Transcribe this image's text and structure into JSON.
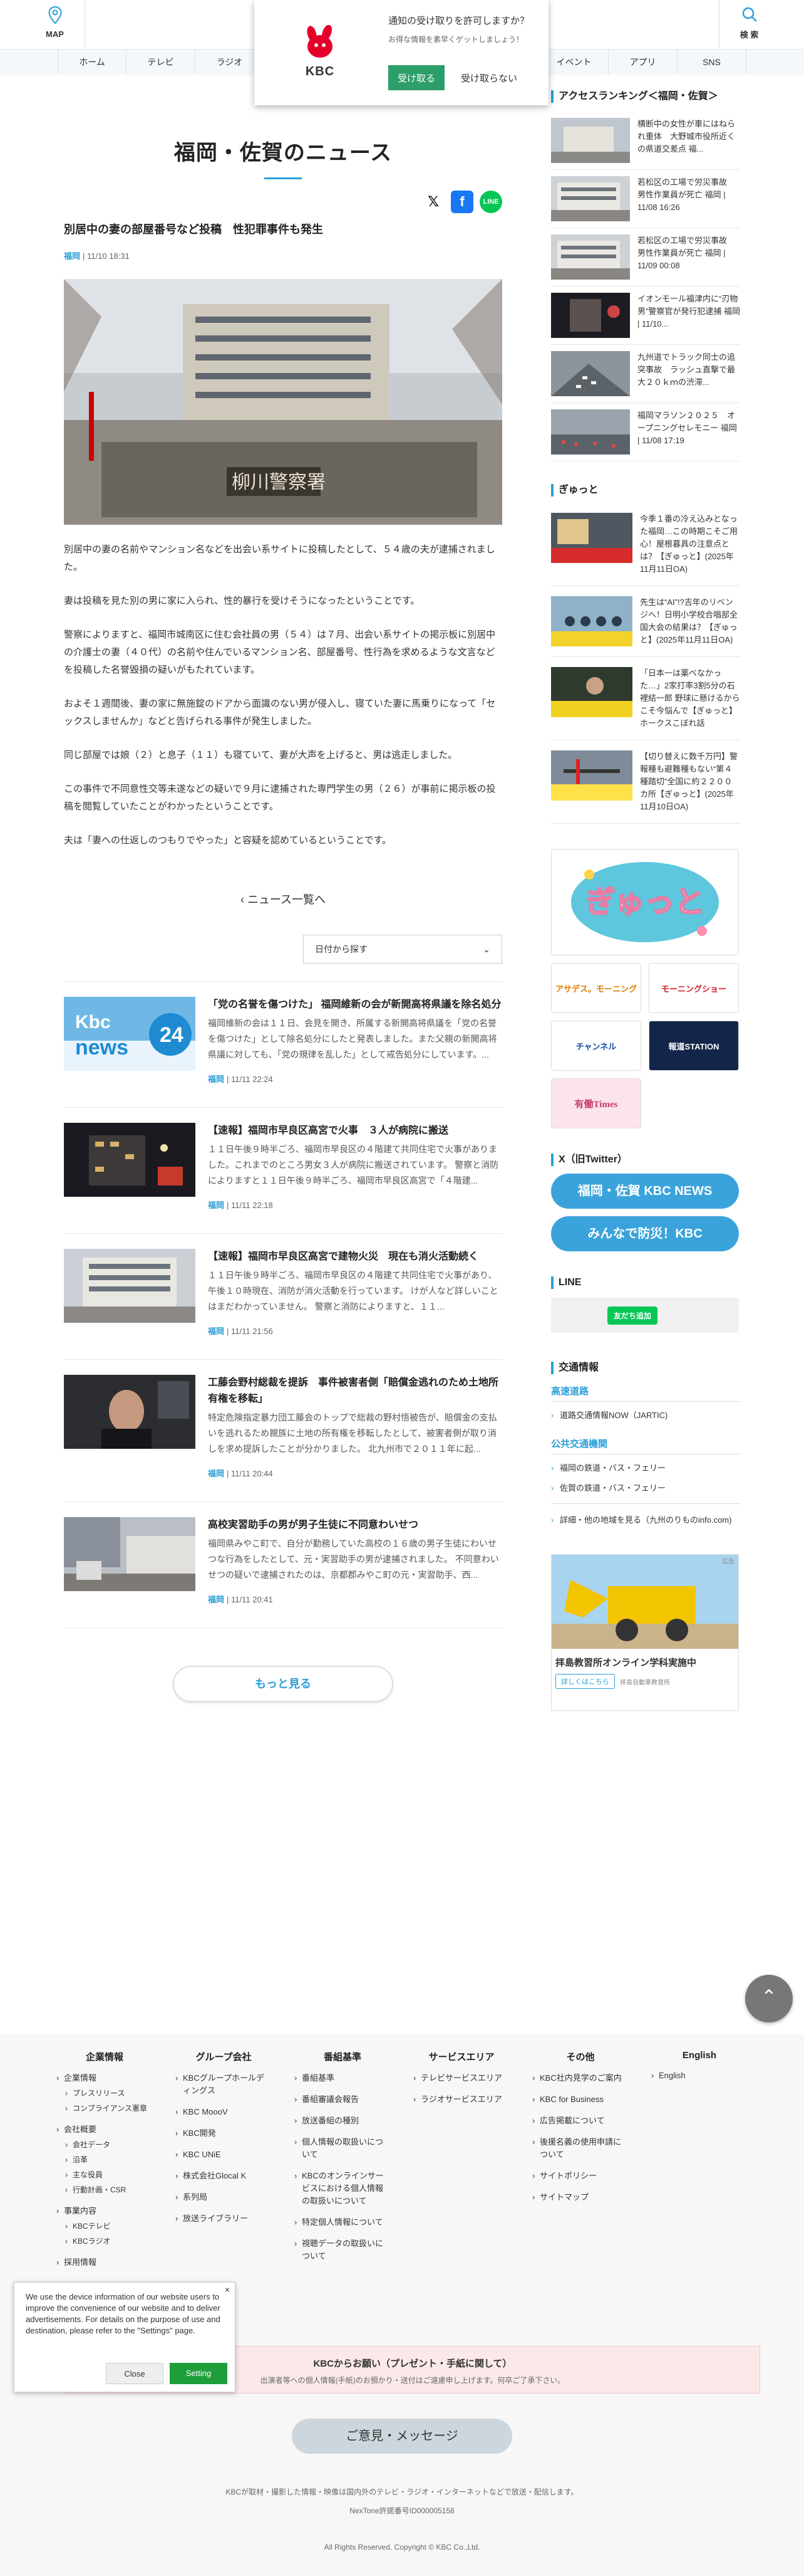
{
  "header": {
    "map_label": "MAP",
    "search_label": "検 索",
    "nav": [
      "ホーム",
      "テレビ",
      "ラジオ",
      "",
      "",
      "",
      "",
      "イベント",
      "アプリ",
      "SNS"
    ]
  },
  "notification": {
    "question": "通知の受け取りを許可しますか？",
    "sub": "お得な情報を素早くゲットしましょう！",
    "allow": "受け取る",
    "deny": "受け取らない",
    "logo_text": "KBC"
  },
  "main": {
    "page_title": "福岡・佐賀のニュース",
    "article": {
      "title": "別居中の妻の部屋番号など投稿　性犯罪事件も発生",
      "category": "福岡",
      "date": "11/10 18:31",
      "body": [
        "別居中の妻の名前やマンション名などを出会い系サイトに投稿したとして、５４歳の夫が逮捕されました。",
        "妻は投稿を見た別の男に家に入られ、性的暴行を受けそうになったということです。",
        "警察によりますと、福岡市城南区に住む会社員の男（５４）は７月、出会い系サイトの掲示板に別居中の介護士の妻（４０代）の名前や住んでいるマンション名、部屋番号、性行為を求めるような文言などを投稿した名誉毀損の疑いがもたれています。",
        "およそ１週間後、妻の家に無施錠のドアから面識のない男が侵入し、寝ていた妻に馬乗りになって「セックスしませんか」などと告げられる事件が発生しました。",
        "同じ部屋では娘（２）と息子（１１）も寝ていて、妻が大声を上げると、男は逃走しました。",
        "この事件で不同意性交等未遂などの疑いで９月に逮捕された専門学生の男（２６）が事前に掲示板の投稿を閲覧していたことがわかったということです。",
        "夫は「妻への仕返しのつもりでやった」と容疑を認めているということです。"
      ]
    },
    "back_label": "ニュース一覧へ",
    "sort_label": "日付から探す",
    "news": [
      {
        "title": "「党の名誉を傷つけた」 福岡維新の会が新開高将県議を除名処分",
        "text": "福岡維新の会は１１日、会見を開き、所属する新開高将県議を「党の名誉を傷つけた」として除名処分にしたと発表しました。また父親の新開高将県議に対しても、「党の規律を乱した」として戒告処分にしています。...",
        "category": "福岡",
        "date": "11/11 22:24"
      },
      {
        "title": "【速報】福岡市早良区高宮で火事　３人が病院に搬送",
        "text": "１１日午後９時半ごろ、福岡市早良区の４階建て共同住宅で火事がありました。これまでのところ男女３人が病院に搬送されています。 警察と消防によりますと１１日午後９時半ごろ、福岡市早良区高宮で「４階建...",
        "category": "福岡",
        "date": "11/11 22:18"
      },
      {
        "title": "【速報】福岡市早良区高宮で建物火災　現在も消火活動続く",
        "text": "１１日午後９時半ごろ、福岡市早良区の４階建て共同住宅で火事があり、午後１０時現在、消防が消火活動を行っています。 けが人など詳しいことはまだわかっていません。 警察と消防によりますと、１１...",
        "category": "福岡",
        "date": "11/11 21:56"
      },
      {
        "title": "工藤会野村総裁を提訴　事件被害者側「賠償金逃れのため土地所有権を移転」",
        "text": "特定危険指定暴力団工藤会のトップで総裁の野村悟被告が、賠償金の支払いを逃れるため親族に土地の所有権を移転したとして、被害者側が取り消しを求め提訴したことが分かりました。 北九州市で２０１１年に起...",
        "category": "福岡",
        "date": "11/11 20:44"
      },
      {
        "title": "高校実習助手の男が男子生徒に不同意わいせつ",
        "text": "福岡県みやこ町で、自分が勤務していた高校の１６歳の男子生徒にわいせつな行為をしたとして、元・実習助手の男が逮捕されました。 不同意わいせつの疑いで逮捕されたのは、京都郡みやこ町の元・実習助手、西...",
        "category": "福岡",
        "date": "11/11 20:41"
      }
    ],
    "more_label": "もっと見る",
    "news_thumb_logo": "Kbc news 24"
  },
  "side": {
    "ranking_title": "アクセスランキング＜福岡・佐賀＞",
    "ranking": [
      "横断中の女性が車にはねられ重体　大野城市役所近くの県道交差点 福...",
      "若松区の工場で労災事故　男性作業員が死亡 福岡 | 11/08 16:26",
      "若松区の工場で労災事故　男性作業員が死亡 福岡 | 11/09 00:08",
      "イオンモール福津内に“刃物男”警察官が発行犯逮捕 福岡 | 11/10...",
      "九州道でトラック同士の追突事故　ラッシュ直撃で最大２０ｋｍの渋滞...",
      "福岡マラソン２０２５　オープニングセレモニー 福岡 | 11/08 17:19"
    ],
    "gyutto_title": "ぎゅっと",
    "gyutto": [
      "今季１番の冷え込みとなった福岡…この時期こそご用心！屋根暮具の注意点とは？【ぎゅっと】(2025年11月11日OA)",
      "先生は“AI”!?吉年のリベンジへ！日明小学校合唱部全国大会の結果は？【ぎゅっと】(2025年11月11日OA)",
      "「日本一は薬べなかった…」2家打率3割5分の石裡結一郎 野球に懸けるからこそ今悩んで【ぎゅっと】ホークスこぼれ話",
      "【切り替えに数千万円】警報種も避難種もない“第４種踏切”全国に約２２００カ所【ぎゅっと】(2025年11月10日OA)"
    ],
    "banner_big": "ぎゅっと",
    "banners": [
      "アサデス。モーニング",
      "モーニングショー",
      "チャンネル",
      "報道STATION",
      "有働Times"
    ],
    "twitter_title": "X（旧Twitter）",
    "twitter_buttons": [
      "福岡・佐賀 KBC NEWS",
      "みんなで防災！KBC"
    ],
    "line_title": "LINE",
    "line_button": "友だち追加",
    "traffic_title": "交通情報",
    "traffic": [
      {
        "head": "高速道路",
        "items": [
          "道路交通情報NOW（JARTIC)"
        ]
      },
      {
        "head": "公共交通機関",
        "items": [
          "福岡の鉄道・バス・フェリー",
          "佐賀の鉄道・バス・フェリー"
        ]
      }
    ],
    "traffic_more": "詳細・他の地域を見る（九州のりものinfo.com)",
    "ad_title": "拝島教習所オンライン学科実施中",
    "ad_btn": "詳しくはこちら",
    "ad_sub": "拝島自動車教習所",
    "ad_tag": "広告"
  },
  "footer": {
    "cols": [
      {
        "title": "企業情報",
        "items": [
          {
            "t": "企業情報"
          },
          {
            "t": "プレスリリース",
            "sub": true
          },
          {
            "t": "コンプライアンス憲章",
            "sub": true
          },
          {
            "t": "会社概要"
          },
          {
            "t": "会社データ",
            "sub": true
          },
          {
            "t": "沿革",
            "sub": true
          },
          {
            "t": "主な役員",
            "sub": true
          },
          {
            "t": "行動計画・CSR",
            "sub": true
          },
          {
            "t": "事業内容"
          },
          {
            "t": "KBCテレビ",
            "sub": true
          },
          {
            "t": "KBCラジオ",
            "sub": true
          },
          {
            "t": "採用情報"
          }
        ]
      },
      {
        "title": "グループ会社",
        "items": [
          {
            "t": "KBCグループホールディングス"
          },
          {
            "t": "KBC MoooV"
          },
          {
            "t": "KBC開発"
          },
          {
            "t": "KBC UNiE"
          },
          {
            "t": "株式会社Glocal K"
          },
          {
            "t": "系列局"
          },
          {
            "t": "放送ライブラリー"
          }
        ]
      },
      {
        "title": "番組基準",
        "items": [
          {
            "t": "番組基準"
          },
          {
            "t": "番組審議会報告"
          },
          {
            "t": "放送番組の種別"
          },
          {
            "t": "個人情報の取扱いについて"
          },
          {
            "t": "KBCのオンラインサービスにおける個人情報の取扱いについて"
          },
          {
            "t": "特定個人情報について"
          },
          {
            "t": "視聴データの取扱いについて"
          }
        ]
      },
      {
        "title": "サービスエリア",
        "items": [
          {
            "t": "テレビサービスエリア"
          },
          {
            "t": "ラジオサービスエリア"
          }
        ]
      },
      {
        "title": "その他",
        "items": [
          {
            "t": "KBC社内見学のご案内"
          },
          {
            "t": "KBC for Business"
          },
          {
            "t": "広告掲載について"
          },
          {
            "t": "後援名義の使用申請について"
          },
          {
            "t": "サイトポリシー"
          },
          {
            "t": "サイトマップ"
          }
        ]
      },
      {
        "title": "English",
        "items": [
          {
            "t": "English"
          }
        ]
      }
    ],
    "request_title": "KBCからお願い（プレゼント・手紙に関して）",
    "request_text": "出演者等への個人情報(手紙)のお預かり・送付はご遠慮申し上げます。何卒ご了承下さい。",
    "opinion": "ご意見・メッセージ",
    "note1": "KBCが取材・撮影した情報・映像は国内外のテレビ・ラジオ・インターネットなどで放送・配信します。",
    "note2": "NexTone許諾番号ID000005158",
    "copyright": "All Rights Reserved. Copyright © KBC Co.,Ltd."
  },
  "cookie": {
    "text": "We use the device information of our website users to improve the convenience of our website and to deliver advertisements. For details on the purpose of use and destination, please refer to the \"Settings\" page.",
    "close": "Close",
    "setting": "Setting"
  },
  "totop": "⌃",
  "colors": {
    "accent": "#2b9fd8",
    "line": "#06c755",
    "allow": "#2c9e6a"
  }
}
